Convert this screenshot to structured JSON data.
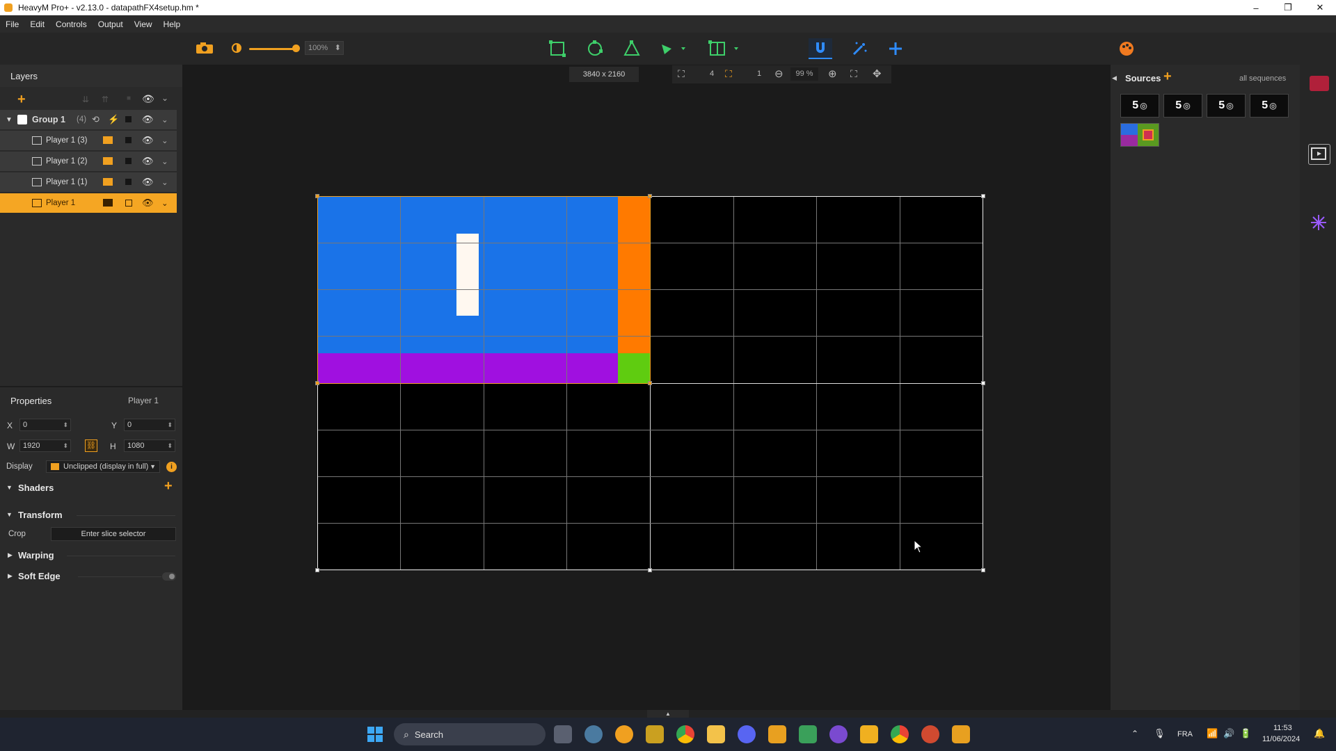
{
  "window": {
    "title": "HeavyM Pro+ - v2.13.0 - datapathFX4setup.hm *",
    "minimize": "–",
    "maximize": "❐",
    "close": "✕"
  },
  "menu": [
    "File",
    "Edit",
    "Controls",
    "Output",
    "View",
    "Help"
  ],
  "toolbar": {
    "zoom_value": "100%",
    "icons": [
      "camera-icon",
      "brightness-icon",
      "rectangle-shape-icon",
      "circle-shape-icon",
      "triangle-shape-icon",
      "pen-tool-icon",
      "grid-shape-icon",
      "magnet-icon",
      "effects-icon",
      "crosshair-icon",
      "palette-icon"
    ]
  },
  "layers": {
    "title": "Layers",
    "group": {
      "label": "Group 1",
      "count": "(4)"
    },
    "items": [
      {
        "label": "Player 1 (3)"
      },
      {
        "label": "Player 1 (2)"
      },
      {
        "label": "Player 1 (1)"
      },
      {
        "label": "Player 1"
      }
    ]
  },
  "properties": {
    "title": "Properties",
    "selected": "Player 1",
    "x_label": "X",
    "x_value": "0",
    "y_label": "Y",
    "y_value": "0",
    "w_label": "W",
    "w_value": "1920",
    "h_label": "H",
    "h_value": "1080",
    "display_label": "Display",
    "display_value": "Unclipped (display in full)",
    "shaders": "Shaders",
    "transform": "Transform",
    "crop_label": "Crop",
    "crop_button": "Enter slice selector",
    "warping": "Warping",
    "soft_edge": "Soft Edge"
  },
  "canvas": {
    "resolution": "3840 x 2160",
    "grid_cols": "4",
    "grid_rows": "1",
    "zoom": "99 %"
  },
  "sources": {
    "title": "Sources",
    "filter": "all sequences",
    "thumbs": [
      "5",
      "5",
      "5",
      "5"
    ]
  },
  "taskbar": {
    "search": "Search",
    "lang": "FRA",
    "time": "11:53",
    "date": "11/06/2024"
  },
  "colors": {
    "accent": "#f5a623",
    "blue": "#1a73e8",
    "orange": "#ff7a00",
    "purple": "#a010e0",
    "green": "#5fcc10"
  }
}
